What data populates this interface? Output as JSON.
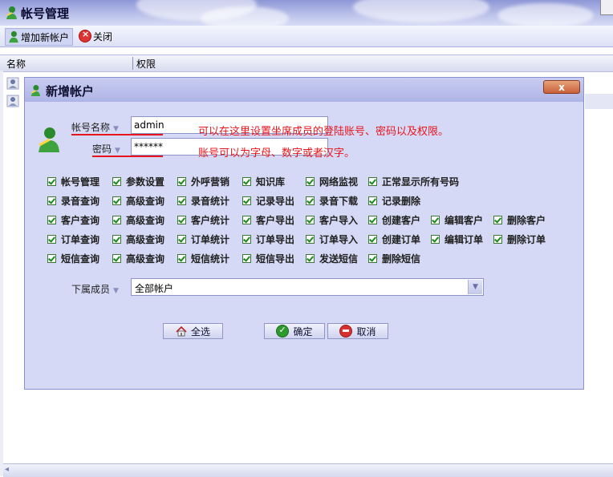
{
  "window": {
    "title": "帐号管理"
  },
  "toolbar": {
    "add_label": "增加新帐户",
    "close_label": "关闭"
  },
  "grid": {
    "col_name": "名称",
    "col_perm": "权限"
  },
  "dialog": {
    "title": "新增帐户",
    "close_glyph": "x",
    "account_label": "帐号名称",
    "account_value": "admin",
    "password_label": "密码",
    "password_value": "******",
    "hint_account": "可以在这里设置坐席成员的登陆账号、密码以及权限。",
    "hint_password": "账号可以为字母、数字或者汉字。",
    "permissions": [
      [
        "帐号管理",
        "参数设置",
        "外呼营销",
        "知识库",
        "网络监视",
        "正常显示所有号码"
      ],
      [
        "录音查询",
        "高级查询",
        "录音统计",
        "记录导出",
        "录音下载",
        "记录删除"
      ],
      [
        "客户查询",
        "高级查询",
        "客户统计",
        "客户导出",
        "客户导入",
        "创建客户",
        "编辑客户",
        "删除客户"
      ],
      [
        "订单查询",
        "高级查询",
        "订单统计",
        "订单导出",
        "订单导入",
        "创建订单",
        "编辑订单",
        "删除订单"
      ],
      [
        "短信查询",
        "高级查询",
        "短信统计",
        "短信导出",
        "发送短信",
        "删除短信"
      ]
    ],
    "subordinate_label": "下属成员",
    "subordinate_value": "全部帐户",
    "select_all_label": "全选",
    "ok_label": "确定",
    "cancel_label": "取消"
  },
  "colors": {
    "hint": "#e8141b",
    "dialog_bg": "#d6d9f5",
    "check": "#1a8a1a"
  }
}
